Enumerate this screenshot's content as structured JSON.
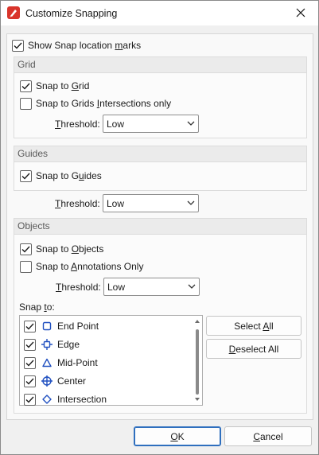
{
  "window": {
    "title": "Customize Snapping",
    "app_icon": "foxit-pdf-icon",
    "close_icon": "close-icon"
  },
  "show_snap_marks": {
    "label_pre": "Show Snap location ",
    "label_acc": "m",
    "label_post": "arks",
    "checked": true
  },
  "grid": {
    "header": "Grid",
    "snap": {
      "label_pre": "Snap to ",
      "label_acc": "G",
      "label_post": "rid",
      "checked": true
    },
    "intersections": {
      "label_pre": "Snap to Grids ",
      "label_acc": "I",
      "label_post": "ntersections only",
      "checked": false
    },
    "threshold_label_pre": "",
    "threshold_label_acc": "T",
    "threshold_label_post": "hreshold:",
    "threshold_value": "Low"
  },
  "guides": {
    "header": "Guides",
    "snap": {
      "label_pre": "Snap to G",
      "label_acc": "u",
      "label_post": "ides",
      "checked": true
    },
    "threshold_label_pre": "",
    "threshold_label_acc": "T",
    "threshold_label_post": "hreshold:",
    "threshold_value": "Low"
  },
  "objects": {
    "header": "Objects",
    "snap": {
      "label_pre": "Snap to ",
      "label_acc": "O",
      "label_post": "bjects",
      "checked": true
    },
    "annotations": {
      "label_pre": "Snap to ",
      "label_acc": "A",
      "label_post": "nnotations Only",
      "checked": false
    },
    "threshold_label_pre": "",
    "threshold_label_acc": "T",
    "threshold_label_post": "hreshold:",
    "threshold_value": "Low",
    "snap_to_label_pre": "Snap ",
    "snap_to_label_acc": "t",
    "snap_to_label_post": "o:",
    "items": [
      {
        "label": "End Point",
        "icon": "end-point-icon",
        "checked": true
      },
      {
        "label": "Edge",
        "icon": "edge-icon",
        "checked": true
      },
      {
        "label": "Mid-Point",
        "icon": "mid-point-icon",
        "checked": true
      },
      {
        "label": "Center",
        "icon": "center-icon",
        "checked": true
      },
      {
        "label": "Intersection",
        "icon": "intersection-icon",
        "checked": true
      }
    ],
    "select_all_pre": "Select ",
    "select_all_acc": "A",
    "select_all_post": "ll",
    "deselect_all_pre": "",
    "deselect_all_acc": "D",
    "deselect_all_post": "eselect All"
  },
  "footer": {
    "ok_acc": "O",
    "ok_post": "K",
    "cancel_acc": "C",
    "cancel_post": "ancel"
  },
  "colors": {
    "accent": "#2f6fbe",
    "icon_blue": "#1f4fc0",
    "check": "#1a1a1a"
  }
}
